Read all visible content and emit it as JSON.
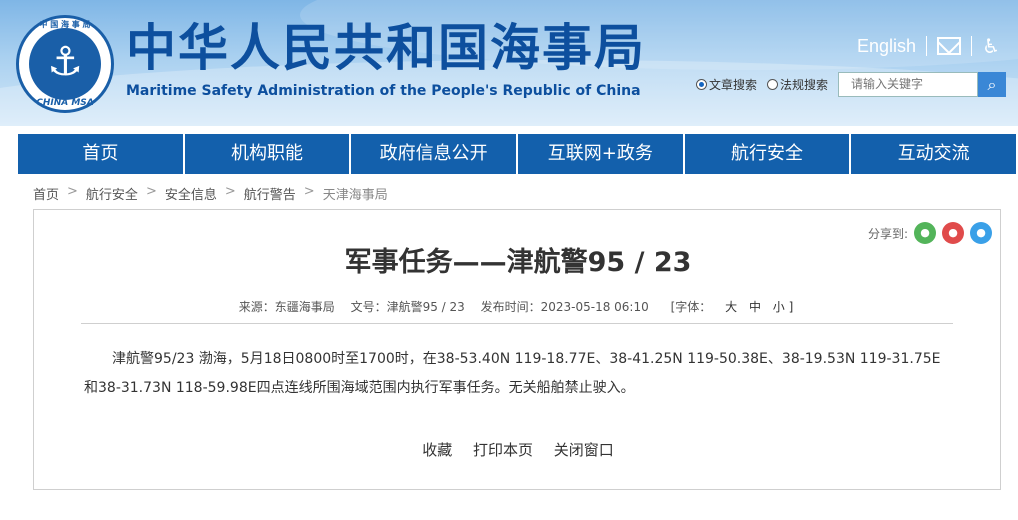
{
  "header": {
    "title_cn": "中华人民共和国海事局",
    "title_en": "Maritime Safety Administration of the People's Republic of China",
    "logo_text_top": "中 国 海 事 局",
    "logo_text_bottom": "CHINA MSA",
    "english_link": "English",
    "brand_color": "#0d4f9e"
  },
  "search": {
    "option_article": "文章搜索",
    "option_law": "法规搜索",
    "placeholder": "请输入关键字"
  },
  "nav": {
    "items": [
      "首页",
      "机构职能",
      "政府信息公开",
      "互联网+政务",
      "航行安全",
      "互动交流"
    ],
    "color": "#1360ac"
  },
  "breadcrumb": [
    "首页",
    "航行安全",
    "安全信息",
    "航行警告",
    "天津海事局"
  ],
  "article": {
    "share_label": "分享到:",
    "title": "军事任务——津航警95 / 23",
    "source": "来源：东疆海事局",
    "doc_no": "文号：津航警95 / 23",
    "publish_time": "发布时间：2023-05-18 06:10",
    "font_size_label": "[字体：",
    "font_large": "大",
    "font_medium": "中",
    "font_small": "小 ]",
    "body": "津航警95/23 渤海，5月18日0800时至1700时，在38-53.40N 119-18.77E、38-41.25N 119-50.38E、38-19.53N 119-31.75E和38-31.73N 118-59.98E四点连线所围海域范围内执行军事任务。无关船舶禁止驶入。",
    "actions": {
      "favorite": "收藏",
      "print": "打印本页",
      "close": "关闭窗口"
    }
  }
}
